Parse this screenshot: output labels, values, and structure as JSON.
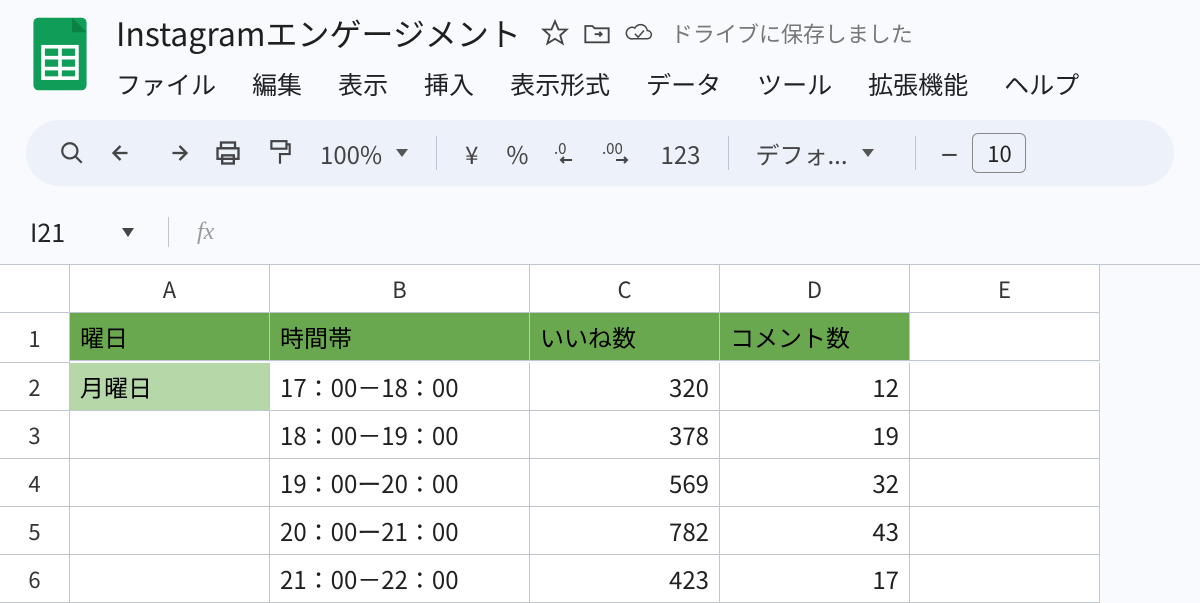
{
  "doc": {
    "title": "Instagramエンゲージメント",
    "save_status": "ドライブに保存しました"
  },
  "menu": {
    "file": "ファイル",
    "edit": "編集",
    "view": "表示",
    "insert": "挿入",
    "format": "表示形式",
    "data": "データ",
    "tools": "ツール",
    "extensions": "拡張機能",
    "help": "ヘルプ"
  },
  "toolbar": {
    "zoom": "100%",
    "currency": "¥",
    "percent": "%",
    "numfmt": "123",
    "font": "デフォ...",
    "fontsize": "10"
  },
  "namebox": "I21",
  "fx_label": "fx",
  "columns": {
    "A": "A",
    "B": "B",
    "C": "C",
    "D": "D",
    "E": "E"
  },
  "headers": {
    "A": "曜日",
    "B": "時間帯",
    "C": "いいね数",
    "D": "コメント数"
  },
  "rows": [
    {
      "n": "1"
    },
    {
      "n": "2",
      "A": "月曜日",
      "B": "17：00－18：00",
      "C": "320",
      "D": "12"
    },
    {
      "n": "3",
      "B": "18：00－19：00",
      "C": "378",
      "D": "19"
    },
    {
      "n": "4",
      "B": "19：00ー20：00",
      "C": "569",
      "D": "32"
    },
    {
      "n": "5",
      "B": "20：00ー21：00",
      "C": "782",
      "D": "43"
    },
    {
      "n": "6",
      "B": "21：00－22：00",
      "C": "423",
      "D": "17"
    }
  ]
}
